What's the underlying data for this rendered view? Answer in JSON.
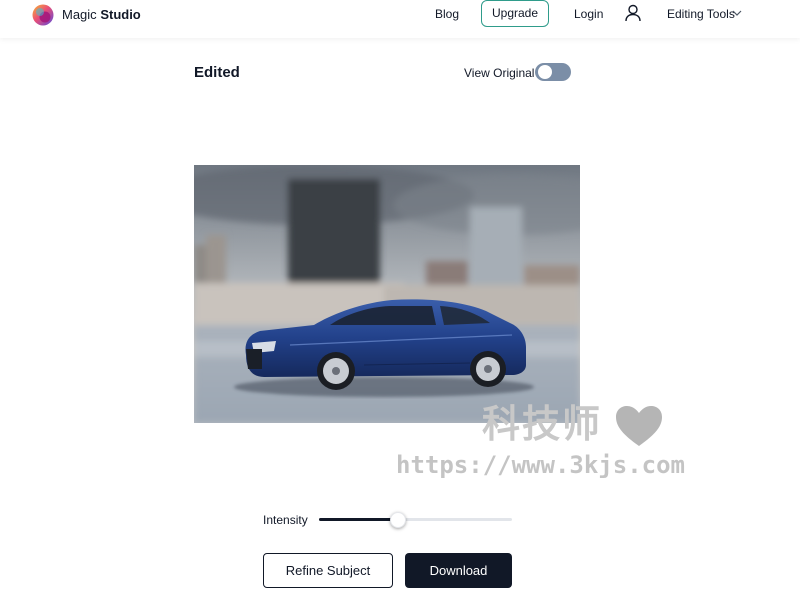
{
  "app": {
    "brand_part1": "Magic",
    "brand_part2": "Studio",
    "accent_color": "#2f9c8b"
  },
  "nav": {
    "blog": "Blog",
    "upgrade": "Upgrade",
    "login": "Login",
    "editing_tools": "Editing Tools",
    "user_icon": "user-icon",
    "dropdown_icon": "chevron-down-icon"
  },
  "editor": {
    "title": "Edited",
    "view_original_label": "View Original",
    "view_original_enabled": false
  },
  "controls": {
    "intensity_label": "Intensity",
    "intensity_value": 0.41,
    "refine_button": "Refine Subject",
    "download_button": "Download"
  },
  "watermark": {
    "text_zh": "科技师",
    "url": "https://www.3kjs.com",
    "icon": "heart-icon"
  }
}
